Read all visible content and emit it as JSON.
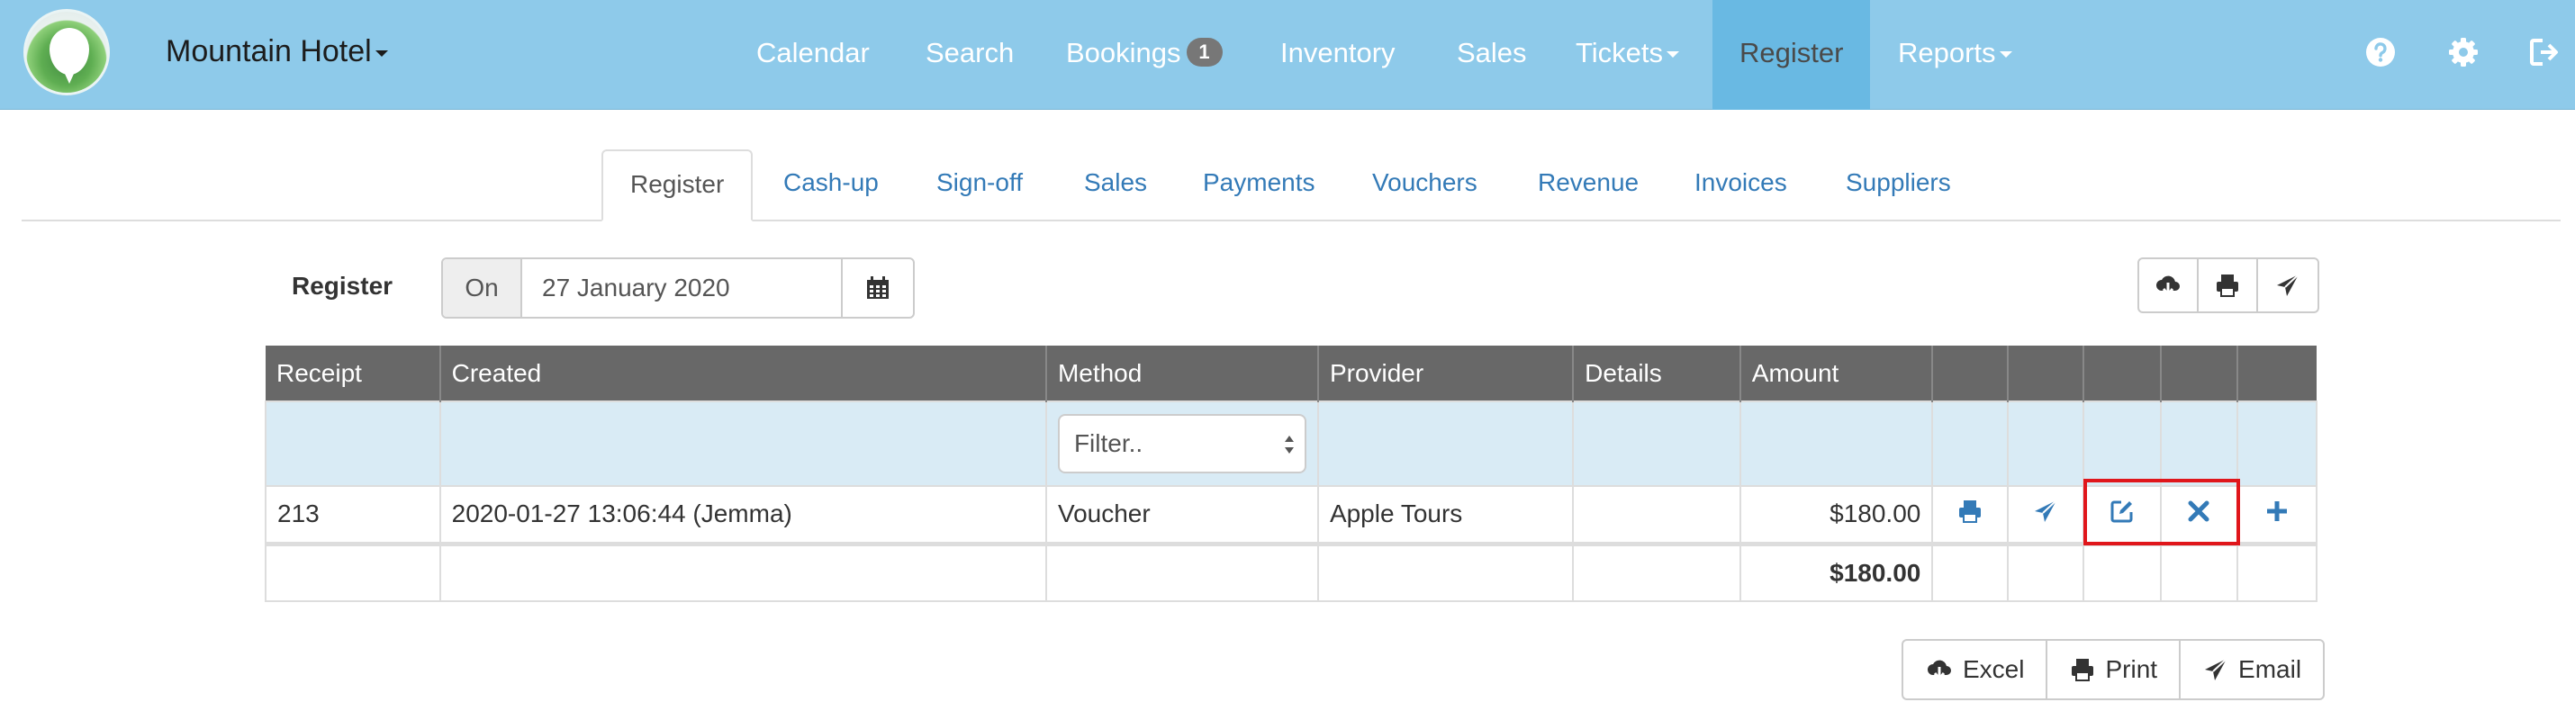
{
  "nav": {
    "hotel_name": "Mountain Hotel",
    "items": [
      {
        "label": "Calendar"
      },
      {
        "label": "Search"
      },
      {
        "label": "Bookings",
        "badge": "1"
      },
      {
        "label": "Inventory"
      },
      {
        "label": "Sales"
      },
      {
        "label": "Tickets"
      },
      {
        "label": "Register"
      },
      {
        "label": "Reports"
      }
    ],
    "active": "Register",
    "icons": [
      "help-icon",
      "settings-icon",
      "logout-icon"
    ]
  },
  "tabs": [
    "Register",
    "Cash-up",
    "Sign-off",
    "Sales",
    "Payments",
    "Vouchers",
    "Revenue",
    "Invoices",
    "Suppliers"
  ],
  "register": {
    "label": "Register",
    "on_label": "On",
    "date": "27 January 2020"
  },
  "table": {
    "headers": [
      "Receipt",
      "Created",
      "Method",
      "Provider",
      "Details",
      "Amount"
    ],
    "filter_placeholder": "Filter..",
    "rows": [
      {
        "receipt": "213",
        "created": "2020-01-27 13:06:44 (Jemma)",
        "method": "Voucher",
        "provider": "Apple Tours",
        "details": "",
        "amount": "$180.00"
      }
    ],
    "total": "$180.00"
  },
  "actions": {
    "excel": "Excel",
    "print": "Print",
    "email": "Email"
  },
  "colors": {
    "navbar": "#8ecaea",
    "nav_active": "#69b9e3",
    "link": "#337ab7",
    "table_header": "#686868",
    "filter_row": "#d9ebf5",
    "highlight": "#e0161b"
  }
}
